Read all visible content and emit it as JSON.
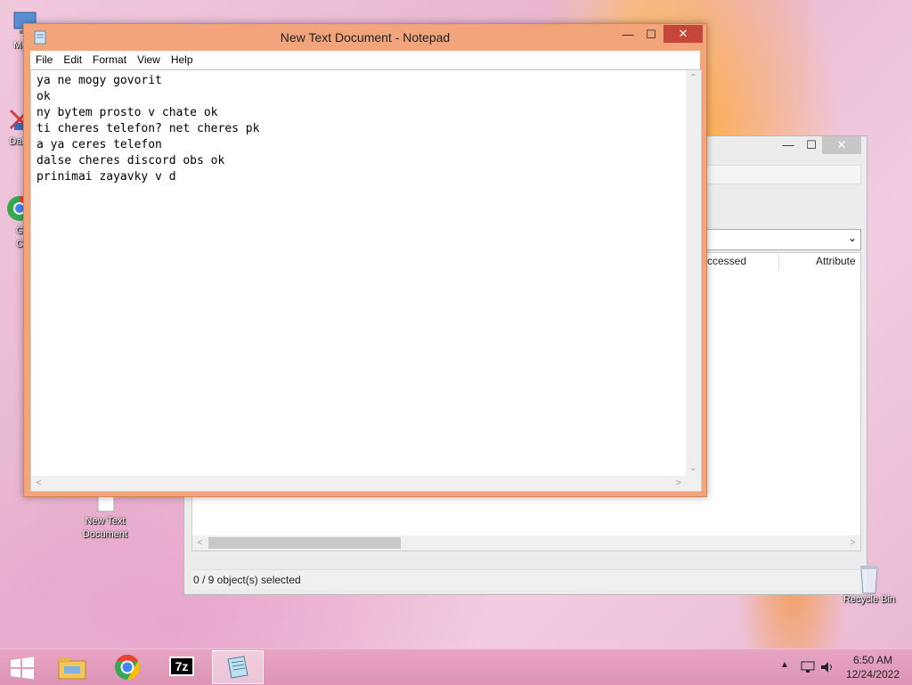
{
  "desktop": {
    "icons": [
      {
        "label": "My C"
      },
      {
        "label": "Data"
      },
      {
        "label": "G\nC"
      },
      {
        "label": "New Text\nDocument"
      },
      {
        "label": "Recycle Bin"
      }
    ]
  },
  "explorer": {
    "column_accessed": "ccessed",
    "column_attributes": "Attribute",
    "status": "0 / 9 object(s) selected"
  },
  "notepad": {
    "title": "New Text Document - Notepad",
    "menu": [
      "File",
      "Edit",
      "Format",
      "View",
      "Help"
    ],
    "text": "ya ne mogy govorit\nok\nny bytem prosto v chate ok\nti cheres telefon? net cheres pk\na ya ceres telefon\ndalse cheres discord obs ok\nprinimai zayavky v d"
  },
  "taskbar": {
    "apps": [
      {
        "icon": "windows-start-icon"
      },
      {
        "icon": "file-explorer-icon"
      },
      {
        "icon": "chrome-icon"
      },
      {
        "icon": "7zip-icon",
        "label": "7z"
      },
      {
        "icon": "notepad-icon"
      }
    ],
    "time": "6:50 AM",
    "date": "12/24/2022"
  },
  "colors": {
    "notepad_frame": "#f2a57b",
    "taskbar": "#dd94b6"
  }
}
